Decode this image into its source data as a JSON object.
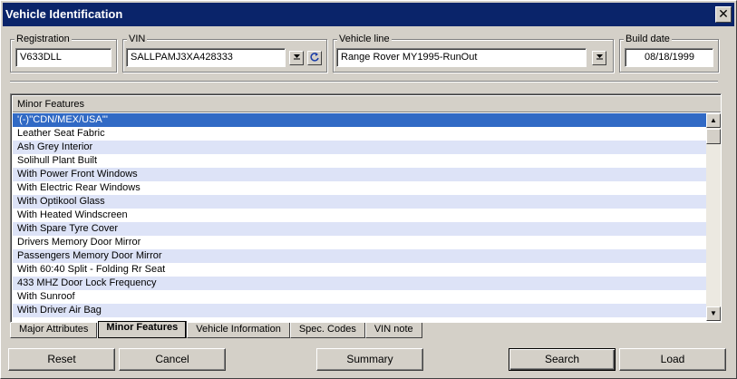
{
  "window": {
    "title": "Vehicle Identification",
    "close_glyph": "✕"
  },
  "registration": {
    "label": "Registration",
    "value": "V633DLL"
  },
  "vin": {
    "label": "VIN",
    "value": "SALLPAMJ3XA428333",
    "dropdown_icon": "dropdown-icon",
    "refresh_icon": "refresh-icon"
  },
  "vehicle_line": {
    "label": "Vehicle line",
    "value": "Range Rover MY1995-RunOut"
  },
  "build_date": {
    "label": "Build date",
    "value": "08/18/1999"
  },
  "list": {
    "header": "Minor Features",
    "rows": [
      "'(-)''CDN/MEX/USA'''",
      "Leather Seat Fabric",
      "Ash Grey Interior",
      "Solihull Plant Built",
      "With Power Front Windows",
      "With Electric Rear Windows",
      "With Optikool Glass",
      "With Heated Windscreen",
      "With Spare Tyre Cover",
      "Drivers Memory Door Mirror",
      "Passengers Memory Door Mirror",
      "With 60:40 Split - Folding Rr Seat",
      "433 MHZ Door Lock Frequency",
      "With Sunroof",
      "With Driver Air Bag"
    ],
    "selected_index": 0,
    "alt_row_color": "#dde3f7",
    "selected_color": "#316ac5"
  },
  "tabs": [
    "Major Attributes",
    "Minor Features",
    "Vehicle Information",
    "Spec. Codes",
    "VIN note"
  ],
  "active_tab": 1,
  "buttons": {
    "reset": "Reset",
    "cancel": "Cancel",
    "summary": "Summary",
    "search": "Search",
    "load": "Load"
  },
  "colors": {
    "title_bar": "#0a246a",
    "face": "#d4d0c8"
  }
}
